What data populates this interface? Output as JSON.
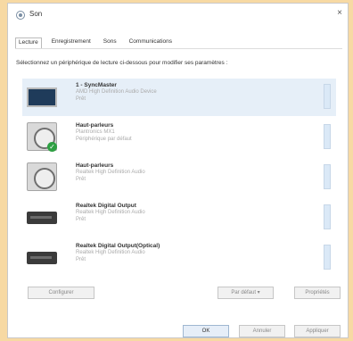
{
  "window": {
    "title": "Son",
    "close_glyph": "×"
  },
  "tabs": [
    {
      "label": "Lecture",
      "active": true
    },
    {
      "label": "Enregistrement",
      "active": false
    },
    {
      "label": "Sons",
      "active": false
    },
    {
      "label": "Communications",
      "active": false
    }
  ],
  "instruction": "Sélectionnez un périphérique de lecture ci-dessous pour modifier ses paramètres :",
  "devices": [
    {
      "name": "1 - SyncMaster",
      "desc": "AMD High Definition Audio Device",
      "status": "Prêt",
      "icon": "monitor-icon",
      "selected": true
    },
    {
      "name": "Haut-parleurs",
      "desc": "Plantronics MX1",
      "status": "Périphérique par défaut",
      "icon": "speaker-icon",
      "default": true
    },
    {
      "name": "Haut-parleurs",
      "desc": "Realtek High Definition Audio",
      "status": "Prêt",
      "icon": "speaker-icon"
    },
    {
      "name": "Realtek Digital Output",
      "desc": "Realtek High Definition Audio",
      "status": "Prêt",
      "icon": "digital-output-icon"
    },
    {
      "name": "Realtek Digital Output(Optical)",
      "desc": "Realtek High Definition Audio",
      "status": "Prêt",
      "icon": "digital-output-icon"
    }
  ],
  "buttons": {
    "configure": "Configurer",
    "set_default": "Par défaut",
    "set_default_arrow": "▾",
    "properties": "Propriétés",
    "ok": "OK",
    "cancel": "Annuler",
    "apply": "Appliquer"
  },
  "colors": {
    "background": "#f7d9a3",
    "selected_row": "#e6eff8",
    "default_check": "#2ea043"
  }
}
